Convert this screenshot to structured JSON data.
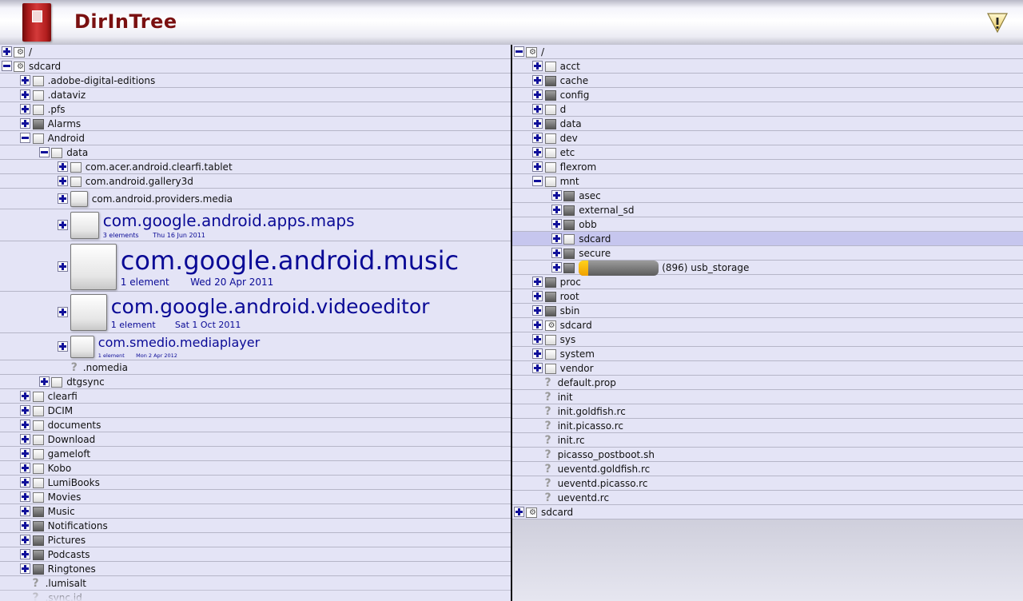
{
  "app": {
    "title": "DirInTree"
  },
  "left_rows": [
    {
      "name": "/",
      "level": 0,
      "toggle": "plus",
      "icon": "gear"
    },
    {
      "name": "sdcard",
      "level": 0,
      "toggle": "minus",
      "icon": "gear"
    },
    {
      "name": ".adobe-digital-editions",
      "level": 1,
      "toggle": "plus",
      "icon": "folder"
    },
    {
      "name": ".dataviz",
      "level": 1,
      "toggle": "plus",
      "icon": "folder"
    },
    {
      "name": ".pfs",
      "level": 1,
      "toggle": "plus",
      "icon": "folder"
    },
    {
      "name": "Alarms",
      "level": 1,
      "toggle": "plus",
      "icon": "folder-dark"
    },
    {
      "name": "Android",
      "level": 1,
      "toggle": "minus",
      "icon": "folder"
    },
    {
      "name": "data",
      "level": 2,
      "toggle": "minus",
      "icon": "folder"
    },
    {
      "name": "com.acer.android.clearfi.tablet",
      "level": 3,
      "toggle": "plus",
      "icon": "folder"
    },
    {
      "name": "com.android.gallery3d",
      "level": 3,
      "toggle": "plus",
      "icon": "folder"
    },
    {
      "name": "com.android.providers.media",
      "level": 3,
      "toggle": "plus",
      "icon": "folder",
      "size": "m"
    },
    {
      "name": "com.google.android.apps.maps",
      "level": 3,
      "toggle": "plus",
      "icon": "folder",
      "size": "l",
      "elements": "3 elements",
      "date": "Thu 16 Jun 2011"
    },
    {
      "name": "com.google.android.music",
      "level": 3,
      "toggle": "plus",
      "icon": "folder",
      "size": "xl",
      "elements": "1 element",
      "date": "Wed 20 Apr 2011"
    },
    {
      "name": "com.google.android.videoeditor",
      "level": 3,
      "toggle": "plus",
      "icon": "folder",
      "size": "lx",
      "elements": "1 element",
      "date": "Sat 1 Oct 2011"
    },
    {
      "name": "com.smedio.mediaplayer",
      "level": 3,
      "toggle": "plus",
      "icon": "folder",
      "size": "ms",
      "elements": "1 element",
      "date": "Mon 2 Apr 2012"
    },
    {
      "name": ".nomedia",
      "level": 3,
      "toggle": "none",
      "icon": "question"
    },
    {
      "name": "dtgsync",
      "level": 2,
      "toggle": "plus",
      "icon": "folder"
    },
    {
      "name": "clearfi",
      "level": 1,
      "toggle": "plus",
      "icon": "folder"
    },
    {
      "name": "DCIM",
      "level": 1,
      "toggle": "plus",
      "icon": "folder"
    },
    {
      "name": "documents",
      "level": 1,
      "toggle": "plus",
      "icon": "folder"
    },
    {
      "name": "Download",
      "level": 1,
      "toggle": "plus",
      "icon": "folder"
    },
    {
      "name": "gameloft",
      "level": 1,
      "toggle": "plus",
      "icon": "folder"
    },
    {
      "name": "Kobo",
      "level": 1,
      "toggle": "plus",
      "icon": "folder"
    },
    {
      "name": "LumiBooks",
      "level": 1,
      "toggle": "plus",
      "icon": "folder"
    },
    {
      "name": "Movies",
      "level": 1,
      "toggle": "plus",
      "icon": "folder"
    },
    {
      "name": "Music",
      "level": 1,
      "toggle": "plus",
      "icon": "folder-dark"
    },
    {
      "name": "Notifications",
      "level": 1,
      "toggle": "plus",
      "icon": "folder-dark"
    },
    {
      "name": "Pictures",
      "level": 1,
      "toggle": "plus",
      "icon": "folder-dark"
    },
    {
      "name": "Podcasts",
      "level": 1,
      "toggle": "plus",
      "icon": "folder-dark"
    },
    {
      "name": "Ringtones",
      "level": 1,
      "toggle": "plus",
      "icon": "folder-dark"
    },
    {
      "name": ".lumisalt",
      "level": 1,
      "toggle": "none",
      "icon": "question"
    },
    {
      "name": ".sync.id",
      "level": 1,
      "toggle": "none",
      "icon": "question"
    }
  ],
  "right_rows": [
    {
      "name": "/",
      "level": 0,
      "toggle": "minus",
      "icon": "gear"
    },
    {
      "name": "acct",
      "level": 1,
      "toggle": "plus",
      "icon": "folder"
    },
    {
      "name": "cache",
      "level": 1,
      "toggle": "plus",
      "icon": "folder-dark"
    },
    {
      "name": "config",
      "level": 1,
      "toggle": "plus",
      "icon": "folder-dark"
    },
    {
      "name": "d",
      "level": 1,
      "toggle": "plus",
      "icon": "folder"
    },
    {
      "name": "data",
      "level": 1,
      "toggle": "plus",
      "icon": "folder-dark"
    },
    {
      "name": "dev",
      "level": 1,
      "toggle": "plus",
      "icon": "folder"
    },
    {
      "name": "etc",
      "level": 1,
      "toggle": "plus",
      "icon": "folder"
    },
    {
      "name": "flexrom",
      "level": 1,
      "toggle": "plus",
      "icon": "folder"
    },
    {
      "name": "mnt",
      "level": 1,
      "toggle": "minus",
      "icon": "folder"
    },
    {
      "name": "asec",
      "level": 2,
      "toggle": "plus",
      "icon": "folder-dark"
    },
    {
      "name": "external_sd",
      "level": 2,
      "toggle": "plus",
      "icon": "folder-dark"
    },
    {
      "name": "obb",
      "level": 2,
      "toggle": "plus",
      "icon": "folder-dark"
    },
    {
      "name": "sdcard",
      "level": 2,
      "toggle": "plus",
      "icon": "folder",
      "selected": true
    },
    {
      "name": "secure",
      "level": 2,
      "toggle": "plus",
      "icon": "folder-dark"
    },
    {
      "name": "(896) usb_storage",
      "level": 2,
      "toggle": "plus",
      "icon": "folder-dark",
      "usage_fraction": 0.12
    },
    {
      "name": "proc",
      "level": 1,
      "toggle": "plus",
      "icon": "folder-dark"
    },
    {
      "name": "root",
      "level": 1,
      "toggle": "plus",
      "icon": "folder-dark"
    },
    {
      "name": "sbin",
      "level": 1,
      "toggle": "plus",
      "icon": "folder-dark"
    },
    {
      "name": "sdcard",
      "level": 1,
      "toggle": "plus",
      "icon": "gear"
    },
    {
      "name": "sys",
      "level": 1,
      "toggle": "plus",
      "icon": "folder"
    },
    {
      "name": "system",
      "level": 1,
      "toggle": "plus",
      "icon": "folder"
    },
    {
      "name": "vendor",
      "level": 1,
      "toggle": "plus",
      "icon": "folder"
    },
    {
      "name": "default.prop",
      "level": 1,
      "toggle": "none",
      "icon": "question"
    },
    {
      "name": "init",
      "level": 1,
      "toggle": "none",
      "icon": "question"
    },
    {
      "name": "init.goldfish.rc",
      "level": 1,
      "toggle": "none",
      "icon": "question"
    },
    {
      "name": "init.picasso.rc",
      "level": 1,
      "toggle": "none",
      "icon": "question"
    },
    {
      "name": "init.rc",
      "level": 1,
      "toggle": "none",
      "icon": "question"
    },
    {
      "name": "picasso_postboot.sh",
      "level": 1,
      "toggle": "none",
      "icon": "question"
    },
    {
      "name": "ueventd.goldfish.rc",
      "level": 1,
      "toggle": "none",
      "icon": "question"
    },
    {
      "name": "ueventd.picasso.rc",
      "level": 1,
      "toggle": "none",
      "icon": "question"
    },
    {
      "name": "ueventd.rc",
      "level": 1,
      "toggle": "none",
      "icon": "question"
    },
    {
      "name": "sdcard",
      "level": 0,
      "toggle": "plus",
      "icon": "gear"
    }
  ],
  "colors": {
    "accent": "#0a0a96",
    "title": "#7a1010",
    "selected": "#c6c6ee",
    "usage_fill": "#f0a000"
  }
}
